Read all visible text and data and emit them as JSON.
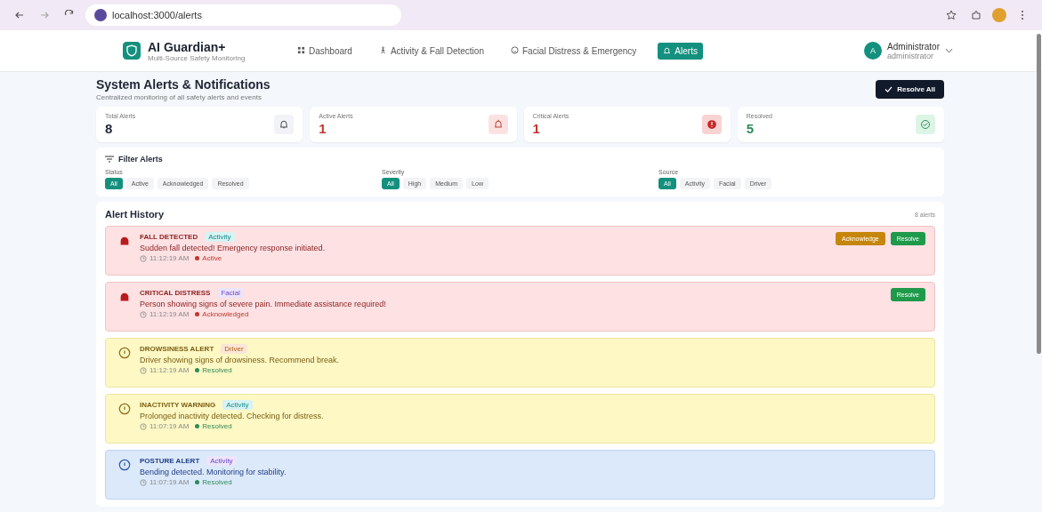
{
  "browser": {
    "url": "localhost:3000/alerts"
  },
  "nav": {
    "title": "AI Guardian+",
    "subtitle": "Multi-Source Safety Monitoring",
    "links": [
      {
        "label": "Dashboard",
        "selected": false
      },
      {
        "label": "Activity & Fall Detection",
        "selected": false
      },
      {
        "label": "Facial Distress & Emergency",
        "selected": false
      },
      {
        "label": "Alerts",
        "selected": true
      }
    ],
    "user": {
      "initial": "A",
      "name": "Administrator",
      "role": "administrator"
    }
  },
  "page": {
    "title": "System Alerts & Notifications",
    "subtitle": "Centralized monitoring of all safety alerts and events",
    "action": "Resolve All"
  },
  "stats": [
    {
      "label": "Total Alerts",
      "value": "8",
      "kind": "total"
    },
    {
      "label": "Active Alerts",
      "value": "1",
      "kind": "active"
    },
    {
      "label": "Critical Alerts",
      "value": "1",
      "kind": "critical"
    },
    {
      "label": "Resolved",
      "value": "5",
      "kind": "resolved"
    }
  ],
  "filters": {
    "title": "Filter Alerts",
    "groups": [
      {
        "label": "Status",
        "options": [
          {
            "label": "All",
            "selected": true
          },
          {
            "label": "Active",
            "selected": false
          },
          {
            "label": "Acknowledged",
            "selected": false
          },
          {
            "label": "Resolved",
            "selected": false
          }
        ]
      },
      {
        "label": "Severity",
        "options": [
          {
            "label": "All",
            "selected": true
          },
          {
            "label": "High",
            "selected": false
          },
          {
            "label": "Medium",
            "selected": false
          },
          {
            "label": "Low",
            "selected": false
          }
        ]
      },
      {
        "label": "Source",
        "options": [
          {
            "label": "All",
            "selected": true
          },
          {
            "label": "Activity",
            "selected": false
          },
          {
            "label": "Facial",
            "selected": false
          },
          {
            "label": "Driver",
            "selected": false
          }
        ]
      }
    ]
  },
  "history": {
    "title": "Alert History",
    "count": "8 alerts",
    "alerts": [
      {
        "kind": "critical",
        "title": "FALL DETECTED",
        "source": "Activity",
        "message": "Sudden fall detected! Emergency response initiated.",
        "time": "11:12:19 AM",
        "status": "Active",
        "actions": [
          "Acknowledge",
          "Resolve"
        ]
      },
      {
        "kind": "critical",
        "title": "CRITICAL DISTRESS",
        "source": "Facial",
        "message": "Person showing signs of severe pain. Immediate assistance required!",
        "time": "11:12:19 AM",
        "status": "Acknowledged",
        "actions": [
          "Resolve"
        ]
      },
      {
        "kind": "warning",
        "title": "DROWSINESS ALERT",
        "source": "Driver",
        "message": "Driver showing signs of drowsiness. Recommend break.",
        "time": "11:12:19 AM",
        "status": "Resolved"
      },
      {
        "kind": "warning",
        "title": "INACTIVITY WARNING",
        "source": "Activity",
        "message": "Prolonged inactivity detected. Checking for distress.",
        "time": "11:07:19 AM",
        "status": "Resolved"
      },
      {
        "kind": "info",
        "title": "POSTURE ALERT",
        "source": "Activity",
        "message": "Bending detected. Monitoring for stability.",
        "time": "11:07:19 AM",
        "status": "Resolved"
      }
    ]
  }
}
